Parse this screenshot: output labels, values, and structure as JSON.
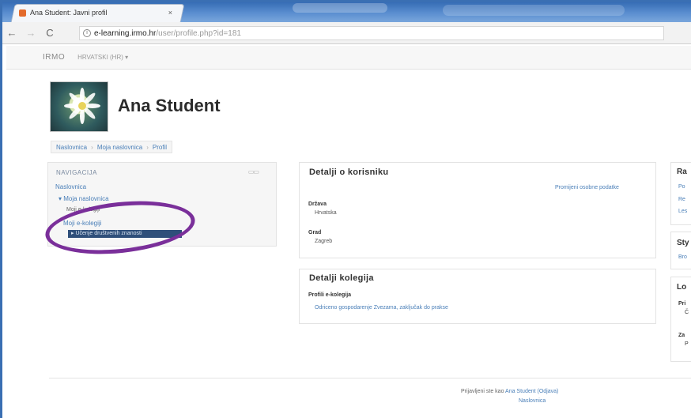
{
  "browser": {
    "tab_title": "Ana Student: Javni profil",
    "tab_close": "×",
    "back": "←",
    "forward": "→",
    "reload": "C",
    "url_host": "e-learning.irmo.hr",
    "url_path": "/user/profile.php?id=181"
  },
  "site": {
    "brand": "IRMO",
    "menu": "HRVATSKI (HR) ▾"
  },
  "header": {
    "title": "Ana Student"
  },
  "breadcrumb": [
    "Naslovnica",
    "Moja naslovnica",
    "Profil"
  ],
  "navigation": {
    "title": "NAVIGACIJA",
    "controls": "▭▭",
    "items": [
      {
        "label": "Naslovnica"
      },
      {
        "label": "▾ Moja naslovnica"
      },
      {
        "label": "Moji e-kolegiji"
      },
      {
        "label": "Moji e-kolegiji"
      }
    ],
    "highlighted": "▸ Učenje društvenih znanosti"
  },
  "user_details": {
    "title": "Detalji o korisniku",
    "edit_link": "Promijeni osobne podatke",
    "country_label": "Država",
    "country_value": "Hrvatska",
    "city_label": "Grad",
    "city_value": "Zagreb"
  },
  "course_details": {
    "title": "Detalji kolegija",
    "profiles_label": "Profili e-kolegija",
    "course_link": "Odriceno gospodarenje Zvezama, zaključak do prakse"
  },
  "right_column": {
    "block1_title": "Ra",
    "block1_links": [
      "Po",
      "Re",
      "Les"
    ],
    "block2_title": "Sty",
    "block2_link": "Bro",
    "block3_title": "Lo",
    "block3_label1": "Pri",
    "block3_value1": "Č",
    "block3_label2": "Za",
    "block3_value2": "P"
  },
  "footer": {
    "prefix": "Prijavljeni ste kao ",
    "user_link": "Ana Student (Odjava)",
    "home_link": "Naslovnica"
  }
}
